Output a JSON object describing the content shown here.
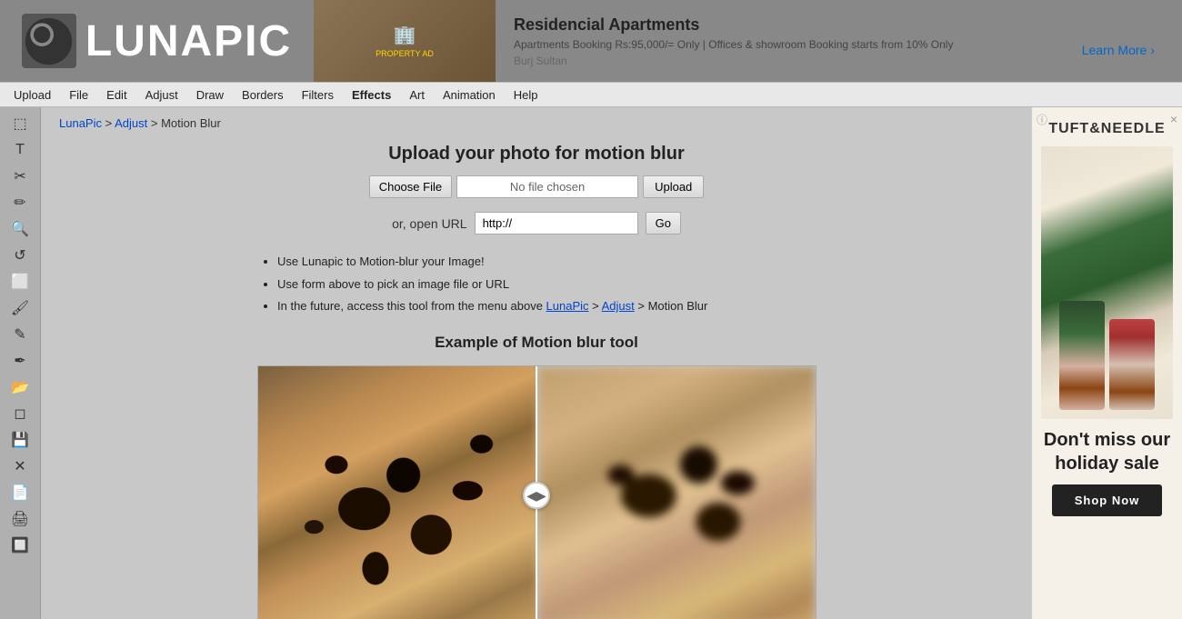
{
  "header": {
    "logo_text": "LUNAPIC",
    "logo_icon": "C"
  },
  "ad_banner": {
    "title": "Residencial Apartments",
    "description": "Apartments Booking Rs:95,000/= Only | Offices & showroom Booking starts from 10% Only",
    "location": "Burj Sultan",
    "learn_more": "Learn More",
    "close": "×",
    "info": "ⓘ"
  },
  "navbar": {
    "items": [
      {
        "label": "Upload",
        "href": "#"
      },
      {
        "label": "File",
        "href": "#"
      },
      {
        "label": "Edit",
        "href": "#"
      },
      {
        "label": "Adjust",
        "href": "#"
      },
      {
        "label": "Draw",
        "href": "#"
      },
      {
        "label": "Borders",
        "href": "#"
      },
      {
        "label": "Filters",
        "href": "#"
      },
      {
        "label": "Effects",
        "href": "#"
      },
      {
        "label": "Art",
        "href": "#"
      },
      {
        "label": "Animation",
        "href": "#"
      },
      {
        "label": "Help",
        "href": "#"
      }
    ]
  },
  "toolbar": {
    "tools": [
      {
        "name": "selection-tool",
        "icon": "⬚"
      },
      {
        "name": "text-tool",
        "icon": "T"
      },
      {
        "name": "cut-tool",
        "icon": "✂"
      },
      {
        "name": "brush-tool",
        "icon": "✏"
      },
      {
        "name": "magnify-tool",
        "icon": "🔍"
      },
      {
        "name": "rotate-tool",
        "icon": "↺"
      },
      {
        "name": "crop-tool",
        "icon": "⬜"
      },
      {
        "name": "paint-tool",
        "icon": "🖌"
      },
      {
        "name": "eyedropper-tool",
        "icon": "💉"
      },
      {
        "name": "pencil-tool",
        "icon": "✒"
      },
      {
        "name": "folder-tool",
        "icon": "📂"
      },
      {
        "name": "eraser-tool",
        "icon": "◻"
      },
      {
        "name": "save-tool",
        "icon": "💾"
      },
      {
        "name": "close-tool",
        "icon": "✕"
      },
      {
        "name": "document-tool",
        "icon": "📄"
      },
      {
        "name": "print-tool",
        "icon": "🖨"
      },
      {
        "name": "stamp-tool",
        "icon": "🔲"
      }
    ]
  },
  "breadcrumb": {
    "lunapic": "LunaPic",
    "separator1": ">",
    "adjust": "Adjust",
    "separator2": ">",
    "current": "Motion Blur"
  },
  "upload_section": {
    "title": "Upload your photo for motion blur",
    "choose_file": "Choose File",
    "no_file": "No file chosen",
    "upload_btn": "Upload",
    "url_label": "or, open URL",
    "url_placeholder": "http://",
    "go_btn": "Go"
  },
  "instructions": {
    "items": [
      "Use Lunapic to Motion-blur your Image!",
      "Use form above to pick an image file or URL",
      "In the future, access this tool from the menu above LunaPic > Adjust > Motion Blur"
    ],
    "lunapic_link": "LunaPic",
    "adjust_link": "Adjust"
  },
  "example": {
    "title": "Example of Motion blur tool",
    "divider_icon": "◀▶"
  },
  "right_ad": {
    "brand": "TUFT&NEEDLE",
    "close": "×",
    "info": "ⓘ",
    "sale_text": "Don't miss our holiday sale",
    "shop_now": "Shop Now"
  }
}
